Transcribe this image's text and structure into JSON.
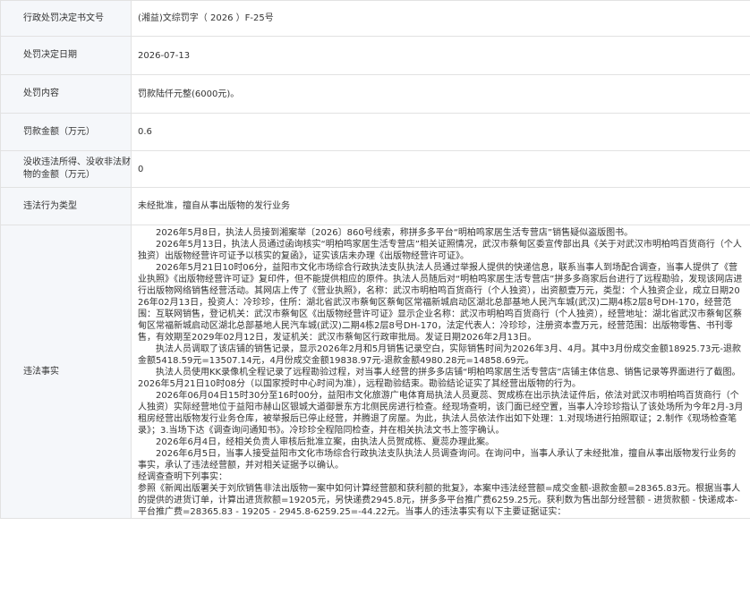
{
  "rows": [
    {
      "label": "行政处罚决定书文号",
      "value": "(湘益)文综罚字（ 2026 ）F-25号"
    },
    {
      "label": "处罚决定日期",
      "value": "2026-07-13"
    },
    {
      "label": "处罚内容",
      "value": "罚款陆仟元整(6000元)。"
    },
    {
      "label": "罚款金额（万元）",
      "value": "0.6"
    },
    {
      "label": "没收违法所得、没收非法财物的金额（万元）",
      "value": "0"
    },
    {
      "label": "违法行为类型",
      "value": "未经批准，擅自从事出版物的发行业务"
    }
  ],
  "facts": {
    "label": "违法事实",
    "paragraphs": [
      "2026年5月8日，执法人员接到湘案举〔2026〕860号线索，称拼多多平台“明柏鸣家居生活专营店”销售疑似盗版图书。",
      "2026年5月13日，执法人员通过函询核实“明柏鸣家居生活专营店”相关证照情况，武汉市蔡甸区委宣传部出具《关于对武汉市明柏鸣百货商行（个人独资）出版物经营许可证予以核实的复函》，证实该店未办理《出版物经营许可证》。",
      "2026年5月21日10时06分，益阳市文化市场综合行政执法支队执法人员通过举报人提供的快递信息，联系当事人到场配合调查，当事人提供了《营业执照》《出版物经营许可证》复印件，但不能提供相应的原件。执法人员随后对“明柏鸣家居生活专营店”拼多多商家后台进行了远程勘验，发现该网店进行出版物网络销售经营活动。其网店上传了《营业执照》，名称：武汉市明柏鸣百货商行（个人独资），出资额壹万元，类型：个人独资企业，成立日期2026年02月13日，投资人：冷珍珍，住所：湖北省武汉市蔡甸区蔡甸区常福新城启动区湖北总部基地人民汽车城(武汉)二期4栋2层8号DH-170，经营范围：互联网销售，登记机关：武汉市蔡甸区《出版物经营许可证》显示企业名称：武汉市明柏鸣百货商行（个人独资），经营地址：湖北省武汉市蔡甸区蔡甸区常福新城启动区湖北总部基地人民汽车城(武汉)二期4栋2层8号DH-170，法定代表人：冷珍珍，注册资本壹万元，经营范围：出版物零售、书刊零售，有效期至2029年02月12日，发证机关：武汉市蔡甸区行政审批局。发证日期2026年2月13日。",
      "执法人员调取了该店铺的销售记录，显示2026年2月和5月销售记录空白，实际销售时间为2026年3月、4月。其中3月份成交金额18925.73元-退款金额5418.59元=13507.14元，4月份成交金额19838.97元-退款金额4980.28元=14858.69元。",
      "执法人员使用KK录像机全程记录了远程勘验过程，对当事人经营的拼多多店铺“明柏鸣家居生活专营店”店铺主体信息、销售记录等界面进行了截图。 2026年5月21日10时08分（以国家授时中心时间为准），远程勘验结束。勘验结论证实了其经营出版物的行为。",
      "2026年06月04日15时30分至16时00分，益阳市文化旅游广电体育局执法人员夏蕊、贺成栋在出示执法证件后，依法对武汉市明柏鸣百货商行（个人独资）实际经营地位于益阳市赫山区银城大道御景东方北侧民房进行检查。经现场查明，该门面已经空置，当事人冷珍珍指认了该处场所为今年2月-3月租房经营出版物发行业务仓库，被举报后已停止经营，并腾退了房屋。为此，执法人员依法作出如下处理：1.对现场进行拍照取证；2.制作《现场检查笔录》；3.当场下达《调查询问通知书》。冷珍珍全程陪同检查，并在相关执法文书上签字确认。",
      "2026年6月4日，经相关负责人审核后批准立案，由执法人员贺成栋、夏蕊办理此案。",
      "2026年6月5日，当事人接受益阳市文化市场综合行政执法支队执法人员调查询问。在询问中，当事人承认了未经批准，擅自从事出版物发行业务的事实，承认了违法经营额，并对相关证据予以确认。"
    ],
    "plain_lines": [
      "经调查查明下列事实：",
      "参照《新闻出版署关于刘欣销售非法出版物一案中如何计算经营额和获利额的批复》，本案中违法经营额=成交金额-退款金额=28365.83元。根据当事人的提供的进货订单，计算出进货款额=19205元，另快递费2945.8元，拼多多平台推广费6259.25元。获利数为售出部分经营额 - 进货款额 - 快递成本-平台推广费=28365.83 - 19205 - 2945.8-6259.25=-44.22元。当事人的违法事实有以下主要证据证实："
    ]
  }
}
